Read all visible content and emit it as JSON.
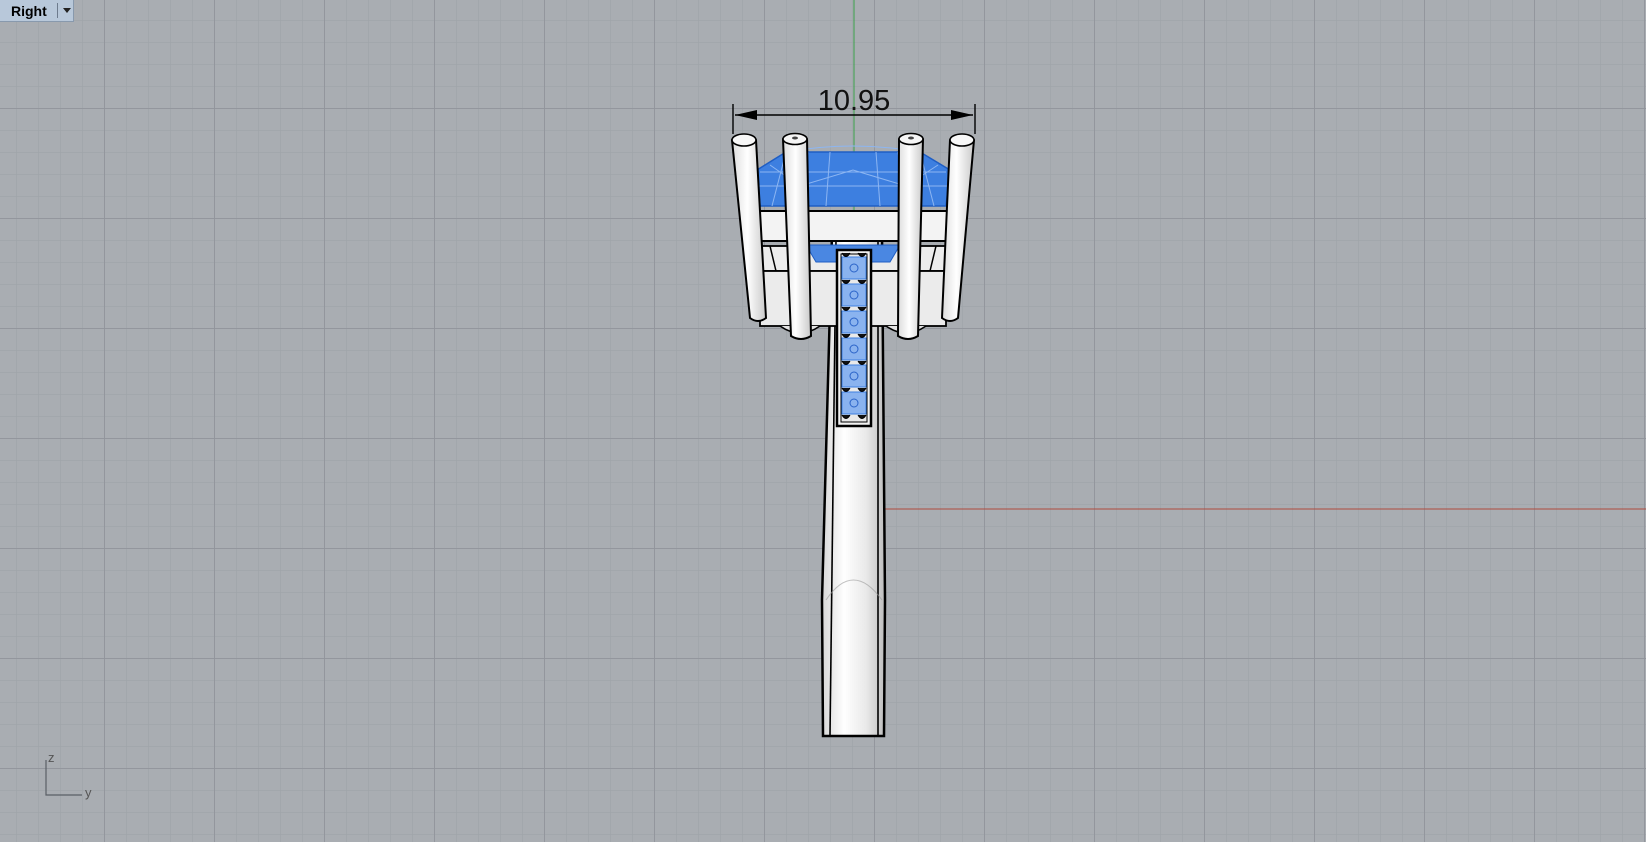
{
  "viewport": {
    "name": "Right",
    "background": "#a9adb2",
    "grid_color": "#91959b"
  },
  "dimension": {
    "value": "10.95"
  },
  "axes": {
    "vertical_label": "z",
    "horizontal_label": "y",
    "world_x_axis_color": "#b04a3e",
    "world_z_axis_color": "#3aa14a"
  },
  "model": {
    "stone_color": "#3d7fe0",
    "metal_color": "#f4f4f4"
  }
}
